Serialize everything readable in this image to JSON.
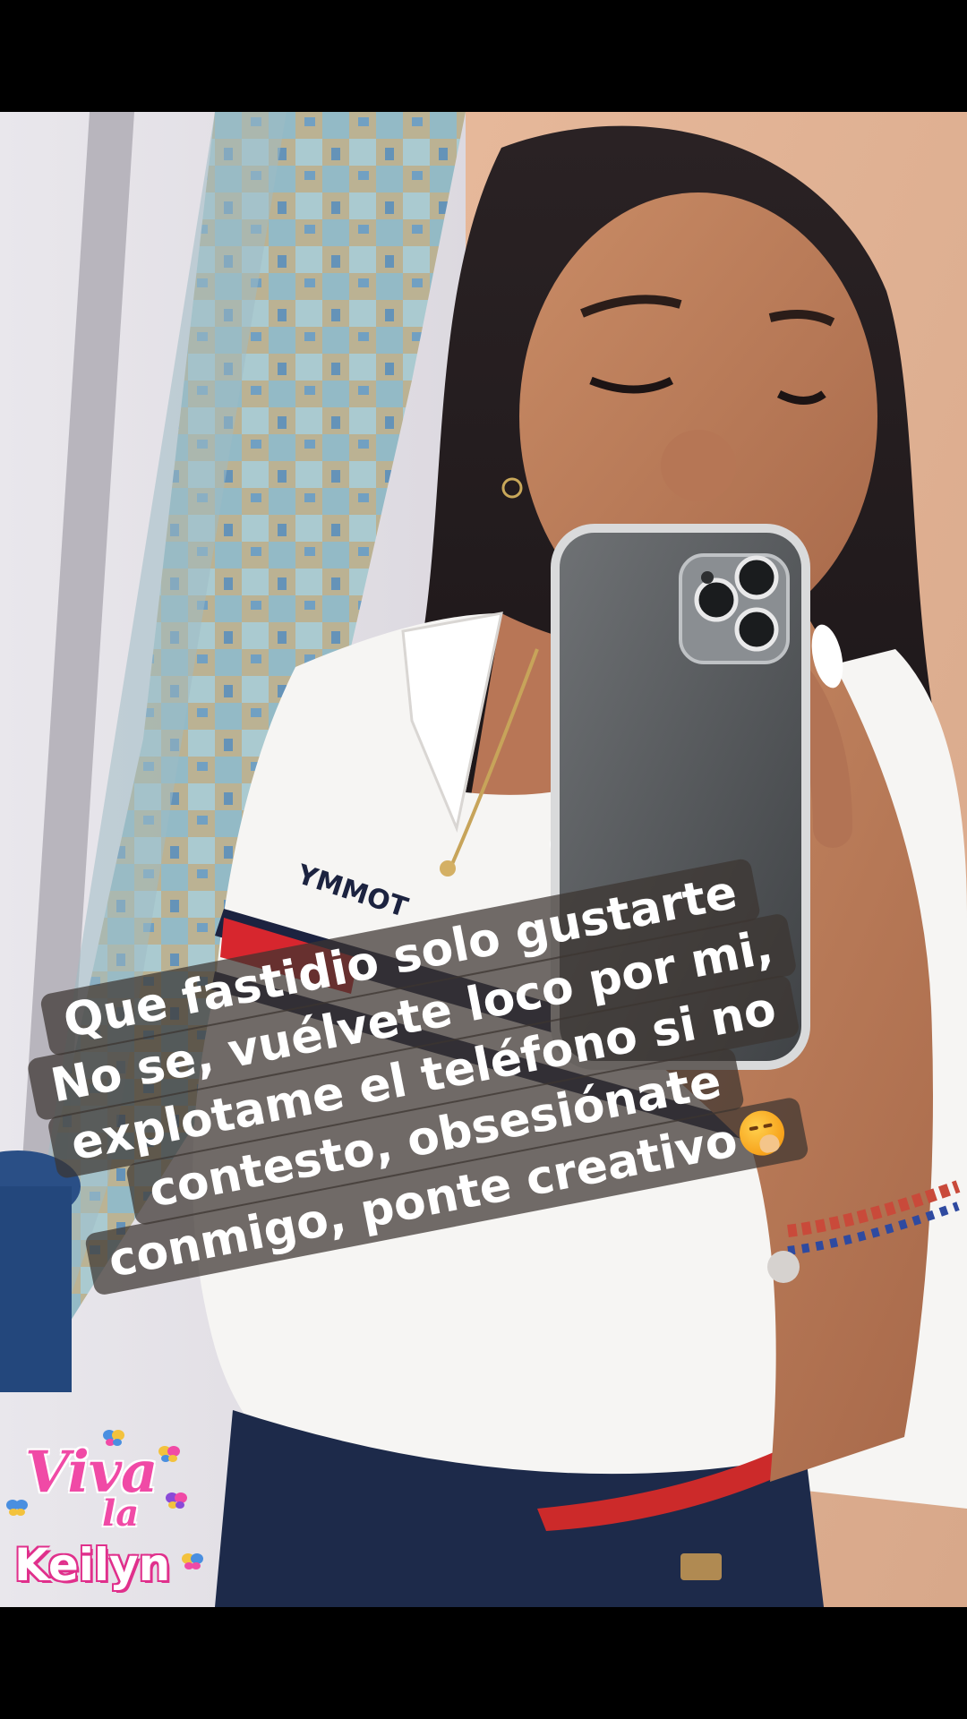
{
  "story": {
    "caption_lines": [
      "Que fastidio solo gustarte",
      "No se, vuélvete loco por mi,",
      "explotame el teléfono si no",
      "contesto, obsesiónate",
      "conmigo, ponte creativo"
    ],
    "caption_emoji": "face-with-hand-over-mouth-icon",
    "shirt_print": "YMMOT",
    "sticker": {
      "line1": "Viva",
      "line2": "la",
      "line3": "Keilyn"
    }
  },
  "colors": {
    "caption_bg": "#3c3430",
    "caption_text": "#ffffff",
    "sticker_pink": "#f04aa6",
    "shirt_red": "#d7262e",
    "shirt_navy": "#1c2340"
  }
}
